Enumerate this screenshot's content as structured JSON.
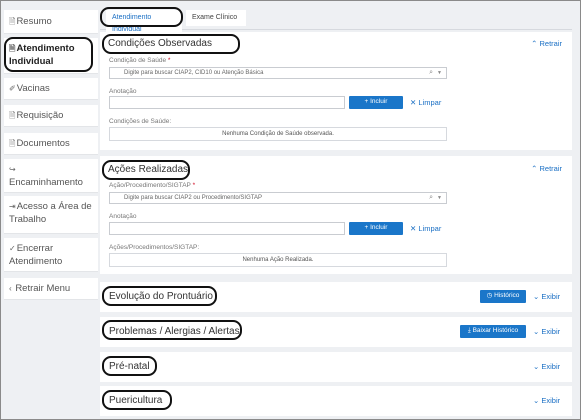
{
  "sidebar": {
    "items": [
      {
        "icon": "document-icon",
        "label": "Resumo"
      },
      {
        "icon": "document-icon",
        "label": "Atendimento Individual"
      },
      {
        "icon": "syringe-icon",
        "label": "Vacinas"
      },
      {
        "icon": "document-icon",
        "label": "Requisição"
      },
      {
        "icon": "document-icon",
        "label": "Documentos"
      },
      {
        "icon": "share-icon",
        "label": "Encaminhamento"
      },
      {
        "icon": "login-icon",
        "label": "Acesso a Área de Trabalho"
      },
      {
        "icon": "check-icon",
        "label": "Encerrar Atendimento"
      },
      {
        "icon": "chevron-left-icon",
        "label": "Retrair Menu"
      }
    ]
  },
  "tabs": [
    {
      "label": "Atendimento Individual"
    },
    {
      "label": "Exame Clínico"
    }
  ],
  "condicoes": {
    "title": "Condições Observadas",
    "collapse": "Retrair",
    "search_label": "Condição de Saúde",
    "required_mark": "*",
    "search_placeholder": "Digite para buscar CIAP2, CID10 ou Atenção Básica",
    "note_label": "Anotação",
    "add_button": "Incluir",
    "clear_button": "Limpar",
    "list_label": "Condições de Saúde:",
    "empty_text": "Nenhuma Condição de Saúde observada."
  },
  "acoes": {
    "title": "Ações Realizadas",
    "collapse": "Retrair",
    "search_label": "Ação/Procedimento/SIGTAP",
    "required_mark": "*",
    "search_placeholder": "Digite para buscar CIAP2 ou Procedimento/SIGTAP",
    "note_label": "Anotação",
    "add_button": "Incluir",
    "clear_button": "Limpar",
    "list_label": "Ações/Procedimentos/SIGTAP:",
    "empty_text": "Nenhuma Ação Realizada."
  },
  "sections": [
    {
      "title": "Evolução do Prontuário",
      "button": "Histórico",
      "button_icon": "history-icon",
      "expand": "Exibir"
    },
    {
      "title": "Problemas / Alergias / Alertas",
      "button": "Baixar Histórico",
      "button_icon": "download-icon",
      "expand": "Exibir"
    },
    {
      "title": "Pré-natal",
      "expand": "Exibir"
    },
    {
      "title": "Puericultura",
      "expand": "Exibir"
    }
  ],
  "glyphs": {
    "expand": "⌄",
    "collapse": "⌃",
    "plus": "+",
    "clear": "✕",
    "search": "⌕",
    "caret": "▼"
  },
  "colors": {
    "accent": "#1a76c9",
    "link": "#1a6fc4",
    "background": "#eef0f3"
  }
}
